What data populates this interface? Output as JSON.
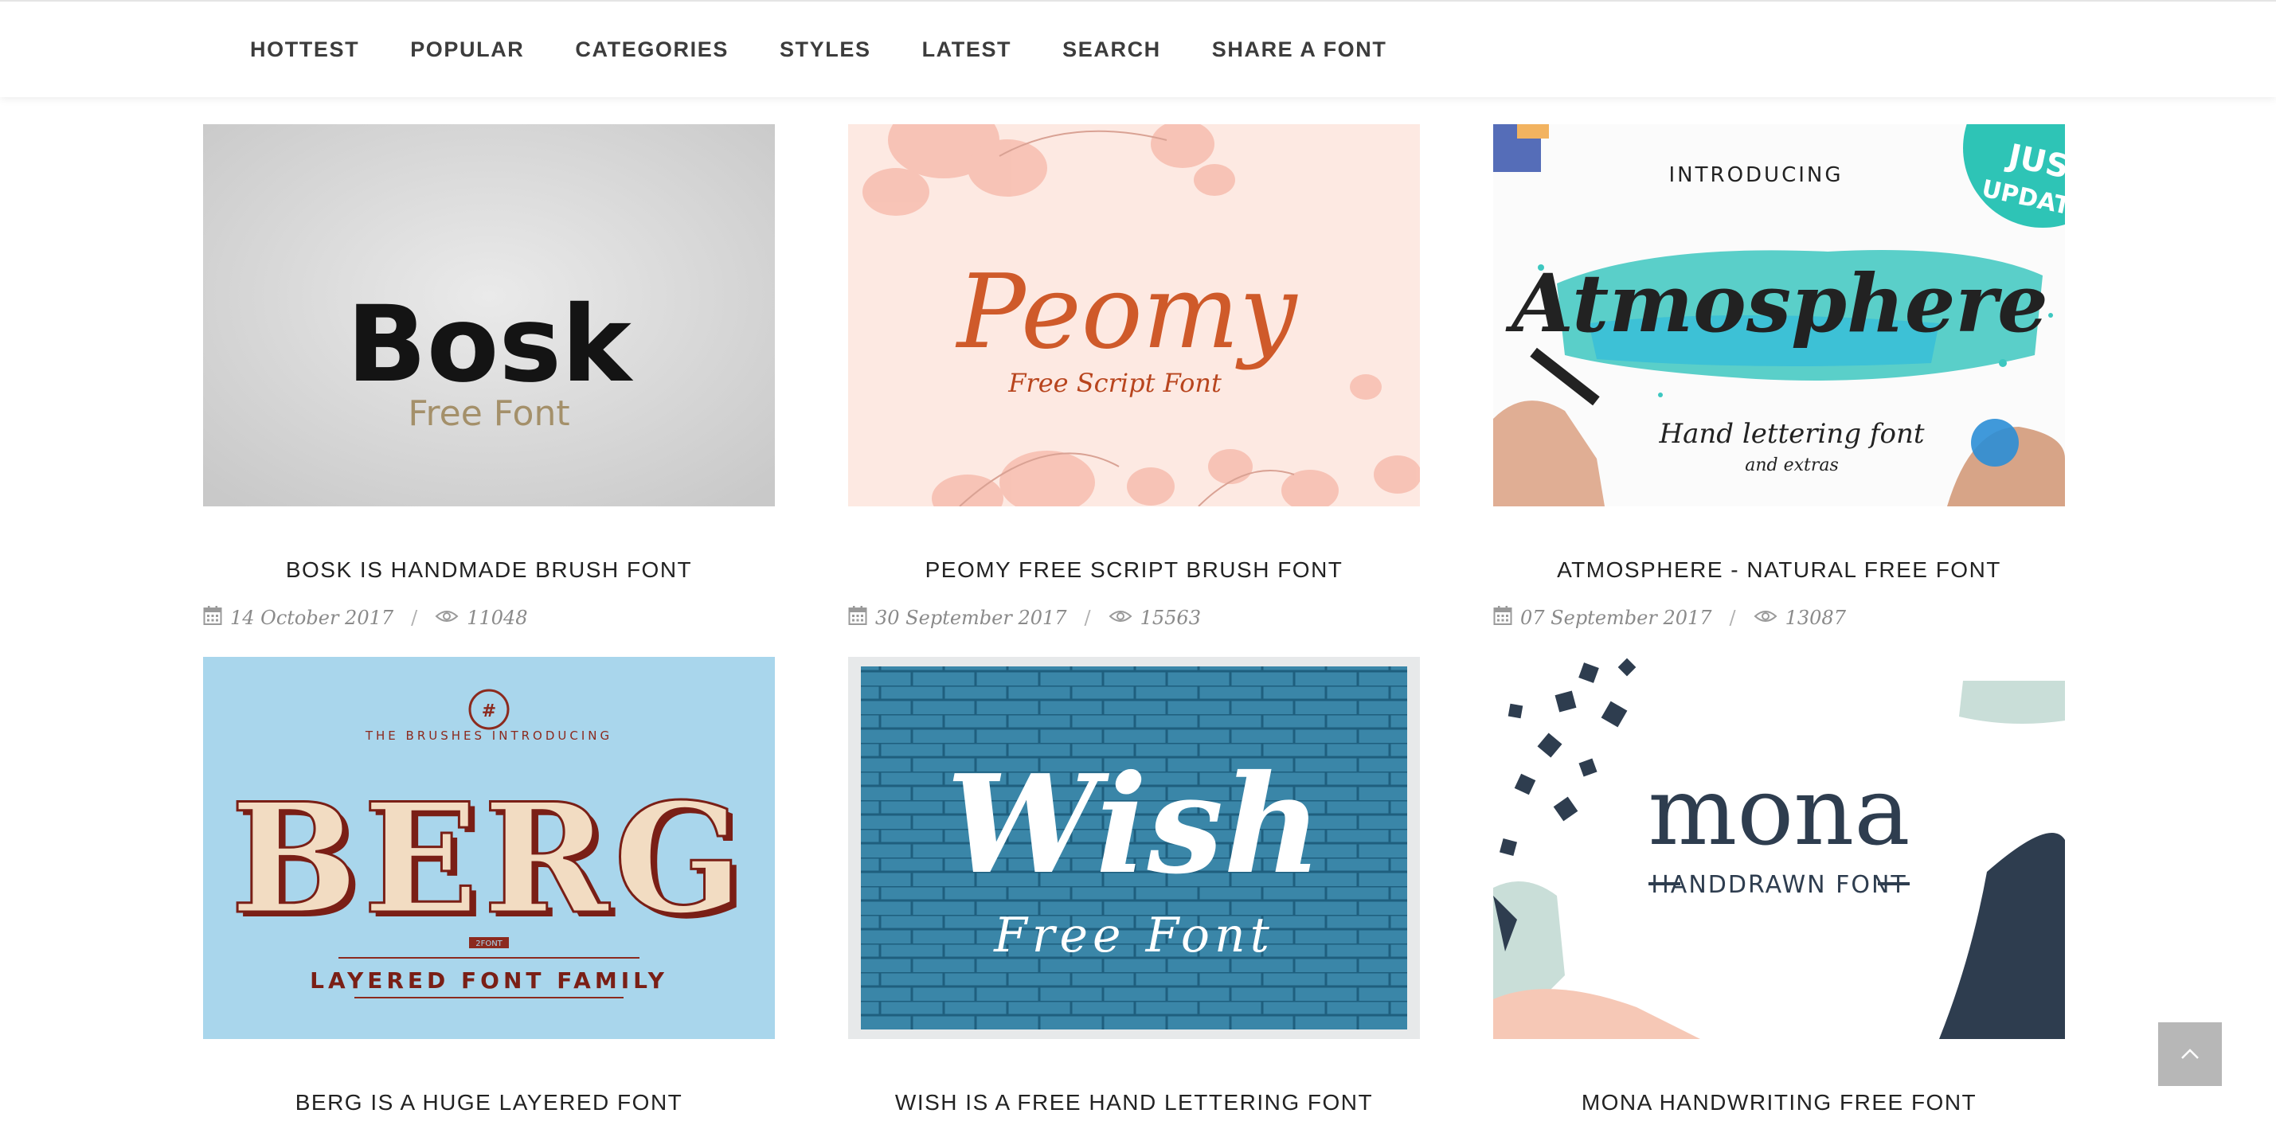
{
  "nav": {
    "items": [
      "HOTTEST",
      "POPULAR",
      "CATEGORIES",
      "STYLES",
      "LATEST",
      "SEARCH",
      "SHARE A FONT"
    ]
  },
  "posts": [
    {
      "title": "BOSK IS HANDMADE BRUSH FONT",
      "date": "14 October 2017",
      "views": "11048",
      "thumb": {
        "heading": "Bosk",
        "sub": "Free Font"
      }
    },
    {
      "title": "PEOMY FREE SCRIPT BRUSH FONT",
      "date": "30 September 2017",
      "views": "15563",
      "thumb": {
        "heading": "Peomy",
        "sub": "Free Script Font"
      }
    },
    {
      "title": "ATMOSPHERE - NATURAL FREE FONT",
      "date": "07 September 2017",
      "views": "13087",
      "thumb": {
        "top": "INTRODUCING",
        "heading": "Atmosphere",
        "sub": "Hand lettering font",
        "sub2": "and extras",
        "badge_line1": "JUST",
        "badge_line2": "UPDATED"
      }
    },
    {
      "title": "BERG IS A HUGE LAYERED FONT",
      "thumb": {
        "arc": "THE BRUSHES INTRODUCING",
        "heading": "BERG",
        "small": "2FONT",
        "sub": "LAYERED FONT FAMILY"
      }
    },
    {
      "title": "WISH IS A FREE HAND LETTERING FONT",
      "thumb": {
        "heading": "Wish",
        "sub": "Free Font"
      }
    },
    {
      "title": "MONA HANDWRITING FREE FONT",
      "thumb": {
        "heading": "mona",
        "sub": "HANDDRAWN FONT"
      }
    }
  ],
  "icons": {
    "date": "calendar-icon",
    "views": "eye-icon",
    "back_to_top": "chevron-up-icon"
  },
  "colors": {
    "nav_text": "#3c3c3c",
    "meta_text": "#8a8a8a",
    "teal_badge": "#2ec4b6"
  }
}
